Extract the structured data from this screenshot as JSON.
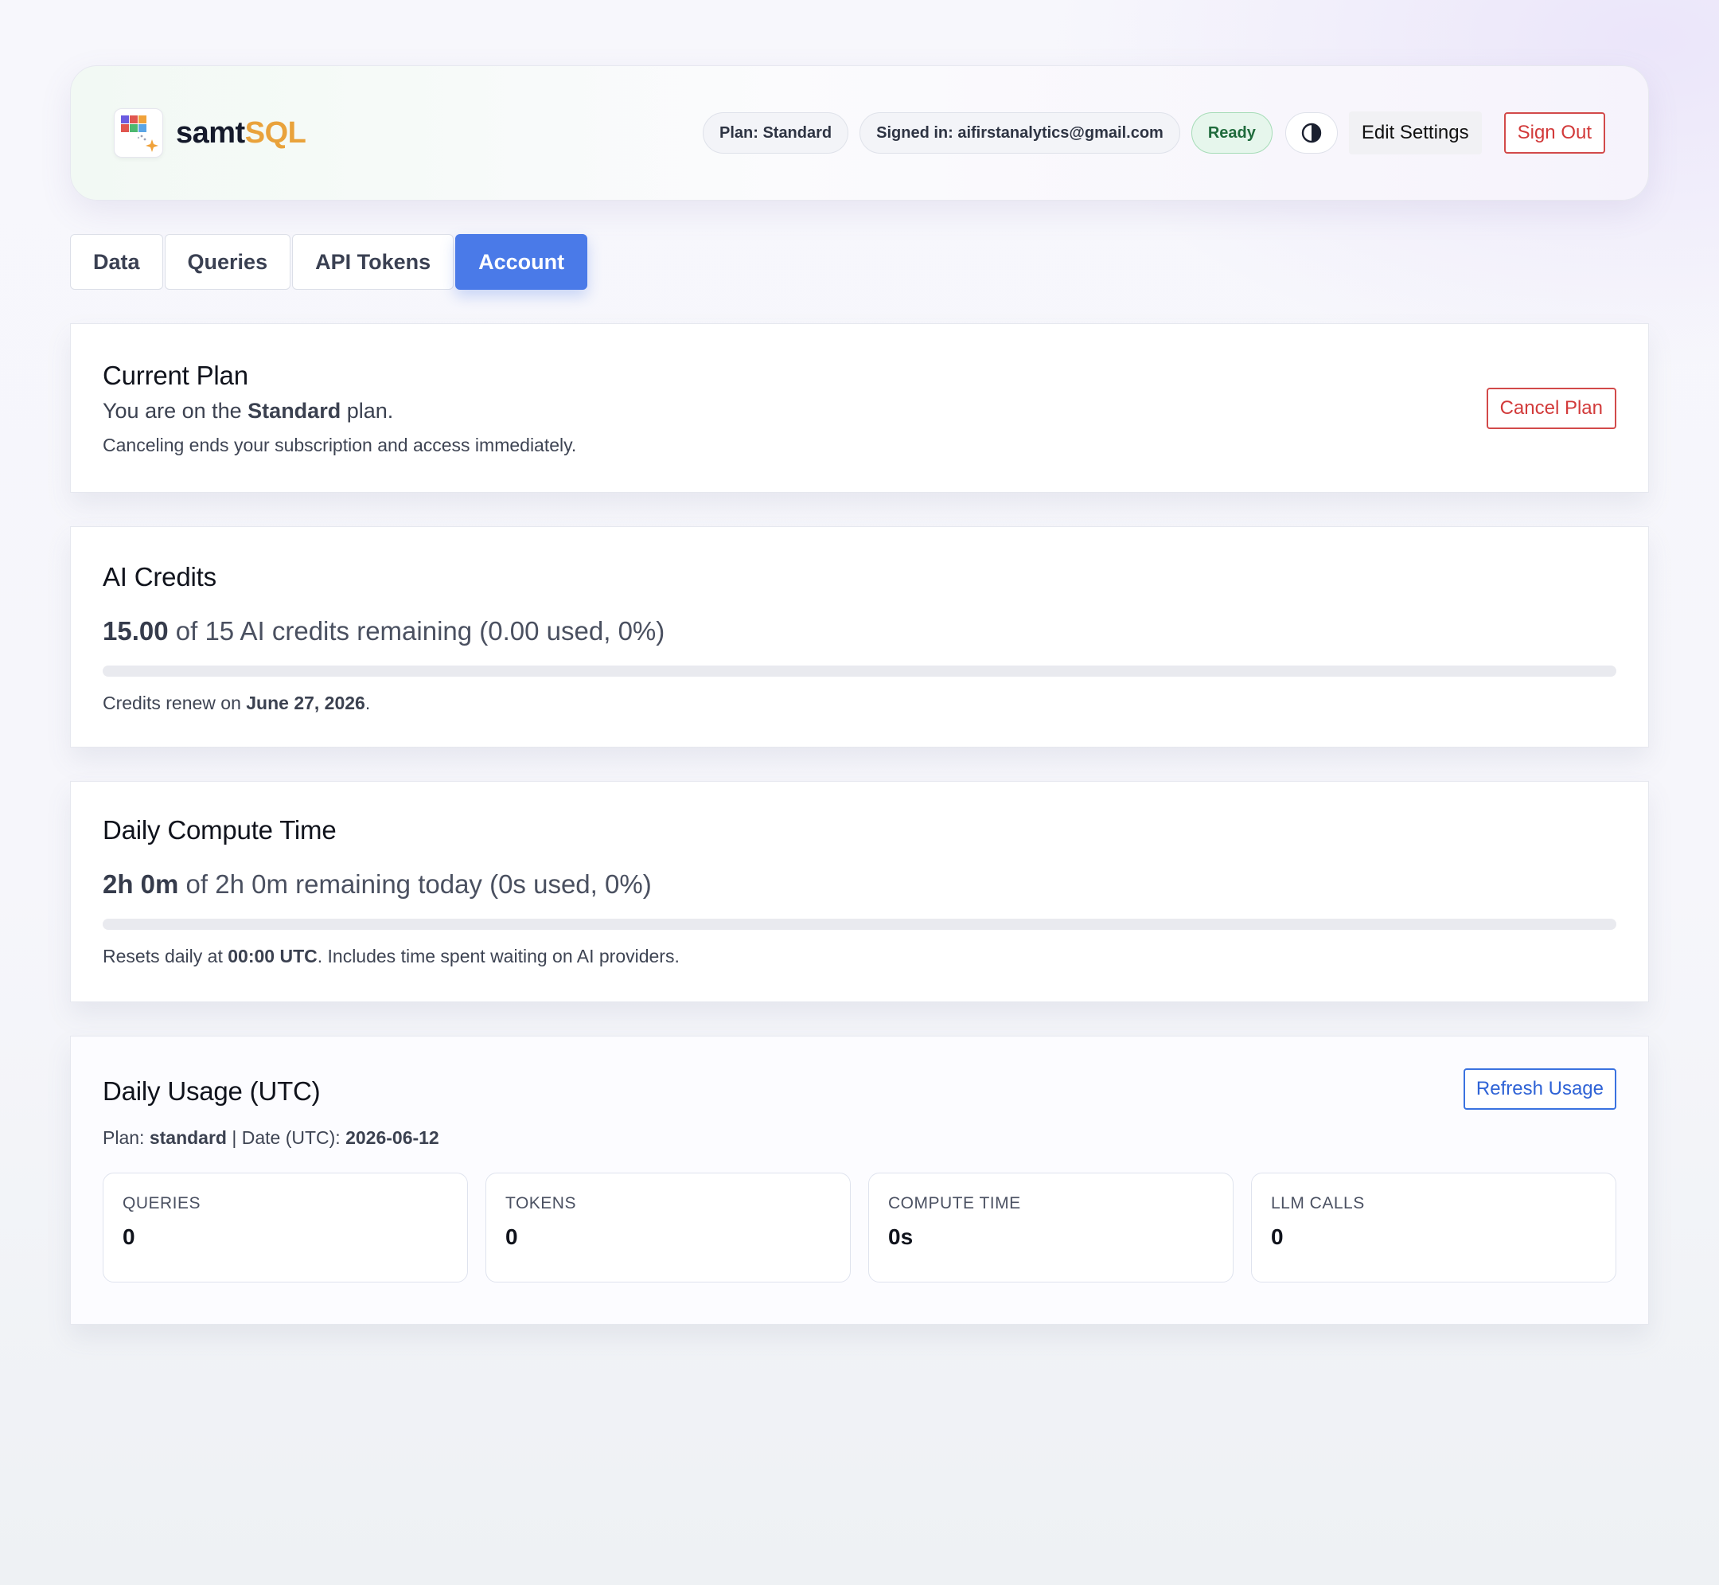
{
  "brand": {
    "name_part1": "samt",
    "name_part2": "SQL"
  },
  "header": {
    "plan_pill": "Plan: Standard",
    "signed_in_pill": "Signed in: aifirstanalytics@gmail.com",
    "status_pill": "Ready",
    "edit_settings": "Edit Settings",
    "sign_out": "Sign Out"
  },
  "tabs": [
    {
      "label": "Data"
    },
    {
      "label": "Queries"
    },
    {
      "label": "API Tokens"
    },
    {
      "label": "Account"
    }
  ],
  "current_plan": {
    "title": "Current Plan",
    "line_prefix": "You are on the ",
    "plan_name": "Standard",
    "line_suffix": " plan.",
    "note": "Canceling ends your subscription and access immediately.",
    "cancel_button": "Cancel Plan"
  },
  "ai_credits": {
    "title": "AI Credits",
    "remaining": "15.00",
    "summary": " of 15 AI credits remaining (0.00 used, 0%)",
    "used_fraction": 0,
    "renew_prefix": "Credits renew on ",
    "renew_date": "June 27, 2026",
    "renew_suffix": "."
  },
  "compute": {
    "title": "Daily Compute Time",
    "remaining": "2h 0m",
    "summary": " of 2h 0m remaining today (0s used, 0%)",
    "used_fraction": 0,
    "reset_prefix": "Resets daily at ",
    "reset_time": "00:00 UTC",
    "reset_suffix": ". Includes time spent waiting on AI providers."
  },
  "usage": {
    "title": "Daily Usage (UTC)",
    "refresh_button": "Refresh Usage",
    "plan_label": "Plan: ",
    "plan_value": "standard",
    "date_label": " | Date (UTC): ",
    "date_value": "2026-06-12",
    "stats": [
      {
        "label": "QUERIES",
        "value": "0"
      },
      {
        "label": "TOKENS",
        "value": "0"
      },
      {
        "label": "COMPUTE TIME",
        "value": "0s"
      },
      {
        "label": "LLM CALLS",
        "value": "0"
      }
    ]
  },
  "colors": {
    "accent": "#4a7ae8",
    "brand_orange": "#e9a23b",
    "danger": "#d23a3a",
    "ready_green": "#1f6b3c"
  },
  "icons": {
    "logo": "grid-sparkle-logo-icon",
    "theme": "contrast-half-circle-icon"
  }
}
